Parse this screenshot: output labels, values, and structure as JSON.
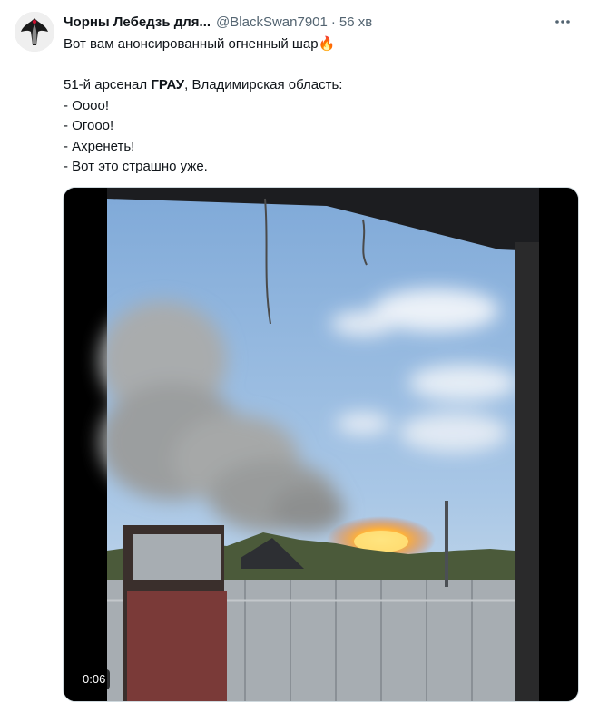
{
  "tweet": {
    "author_name": "Чорны Лебедзь для...",
    "handle": "@BlackSwan7901",
    "separator": "·",
    "time": "56 хв",
    "lines": [
      "Вот вам анонсированный огненный шар",
      "",
      "51-й арсенал ",
      "- Оооо!",
      "- Огооо!",
      "- Ахренеть!",
      "- Вот это страшно уже."
    ],
    "emoji": "🔥",
    "bold_word": "ГРАУ",
    "line3_suffix": ", Владимирская область:"
  },
  "media": {
    "duration": "0:06"
  },
  "icons": {
    "avatar": "black-swan-avatar",
    "more": "more-options-icon"
  },
  "colors": {
    "text": "#0f1419",
    "secondary": "#536471",
    "fire": "#ff9a1a",
    "sky": "#8fb6df"
  }
}
